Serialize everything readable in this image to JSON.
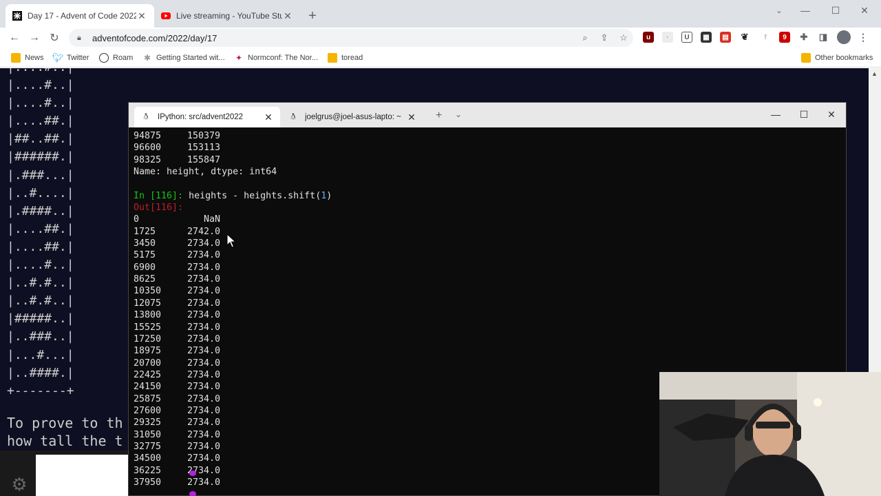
{
  "browser": {
    "tabs": [
      {
        "title": "Day 17 - Advent of Code 2022",
        "active": true
      },
      {
        "title": "Live streaming - YouTube Studio",
        "active": false
      }
    ],
    "url": "adventofcode.com/2022/day/17",
    "bookmarks": [
      "News",
      "Twitter",
      "Roam",
      "Getting Started wit...",
      "Normconf: The Nor...",
      "toread"
    ],
    "other_bookmarks": "Other bookmarks"
  },
  "aoc": {
    "art": "|....#..|\n|....#..|\n|....#..|\n|....##.|\n|##..##.|\n|######.|\n|.###...|\n|..#....|\n|.####..|\n|....##.|\n|....##.|\n|....#..|\n|..#.#..|\n|..#.#..|\n|#####..|\n|..###..|\n|...#...|\n|..####.|\n+-------+",
    "text": "To prove to th\nhow tall the t"
  },
  "terminal": {
    "tabs": [
      {
        "title": "IPython: src/advent2022",
        "active": true
      },
      {
        "title": "joelgrus@joel-asus-lapto: ~",
        "active": false
      }
    ],
    "pre_rows": [
      [
        "94875",
        "150379"
      ],
      [
        "96600",
        "153113"
      ],
      [
        "98325",
        "155847"
      ]
    ],
    "series_footer": "Name: height, dtype: int64",
    "in_prompt": "In [116]:",
    "command_before": " heights - heights.shift(",
    "command_num": "1",
    "command_after": ")",
    "out_prompt": "Out[116]:",
    "result_rows": [
      [
        "0",
        "NaN"
      ],
      [
        "1725",
        "2742.0"
      ],
      [
        "3450",
        "2734.0"
      ],
      [
        "5175",
        "2734.0"
      ],
      [
        "6900",
        "2734.0"
      ],
      [
        "8625",
        "2734.0"
      ],
      [
        "10350",
        "2734.0"
      ],
      [
        "12075",
        "2734.0"
      ],
      [
        "13800",
        "2734.0"
      ],
      [
        "15525",
        "2734.0"
      ],
      [
        "17250",
        "2734.0"
      ],
      [
        "18975",
        "2734.0"
      ],
      [
        "20700",
        "2734.0"
      ],
      [
        "22425",
        "2734.0"
      ],
      [
        "24150",
        "2734.0"
      ],
      [
        "25875",
        "2734.0"
      ],
      [
        "27600",
        "2734.0"
      ],
      [
        "29325",
        "2734.0"
      ],
      [
        "31050",
        "2734.0"
      ],
      [
        "32775",
        "2734.0"
      ],
      [
        "34500",
        "2734.0"
      ],
      [
        "36225",
        "2734.0"
      ],
      [
        "37950",
        "2734.0"
      ]
    ]
  },
  "colors": {
    "aoc_bg": "#0f0f23",
    "terminal_bg": "#0c0c0c",
    "prompt_in": "#13c613",
    "prompt_out": "#c01c28"
  }
}
